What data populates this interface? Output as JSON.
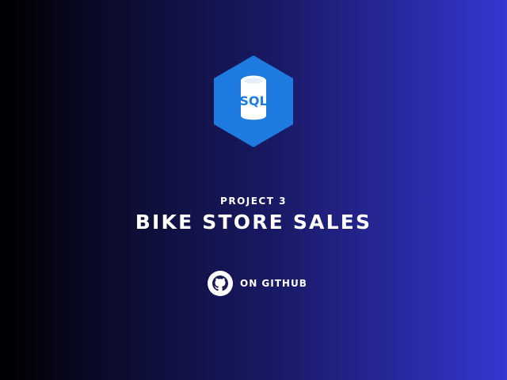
{
  "logo": {
    "icon": "sql-database-icon",
    "text": "SQL",
    "color": "#1e7be0"
  },
  "project": {
    "kicker": "PROJECT 3",
    "title": "BIKE STORE SALES"
  },
  "github": {
    "icon": "github-icon",
    "label": "ON GITHUB"
  },
  "colors": {
    "background_start": "#000000",
    "background_end": "#3536cf",
    "text": "#ffffff"
  }
}
